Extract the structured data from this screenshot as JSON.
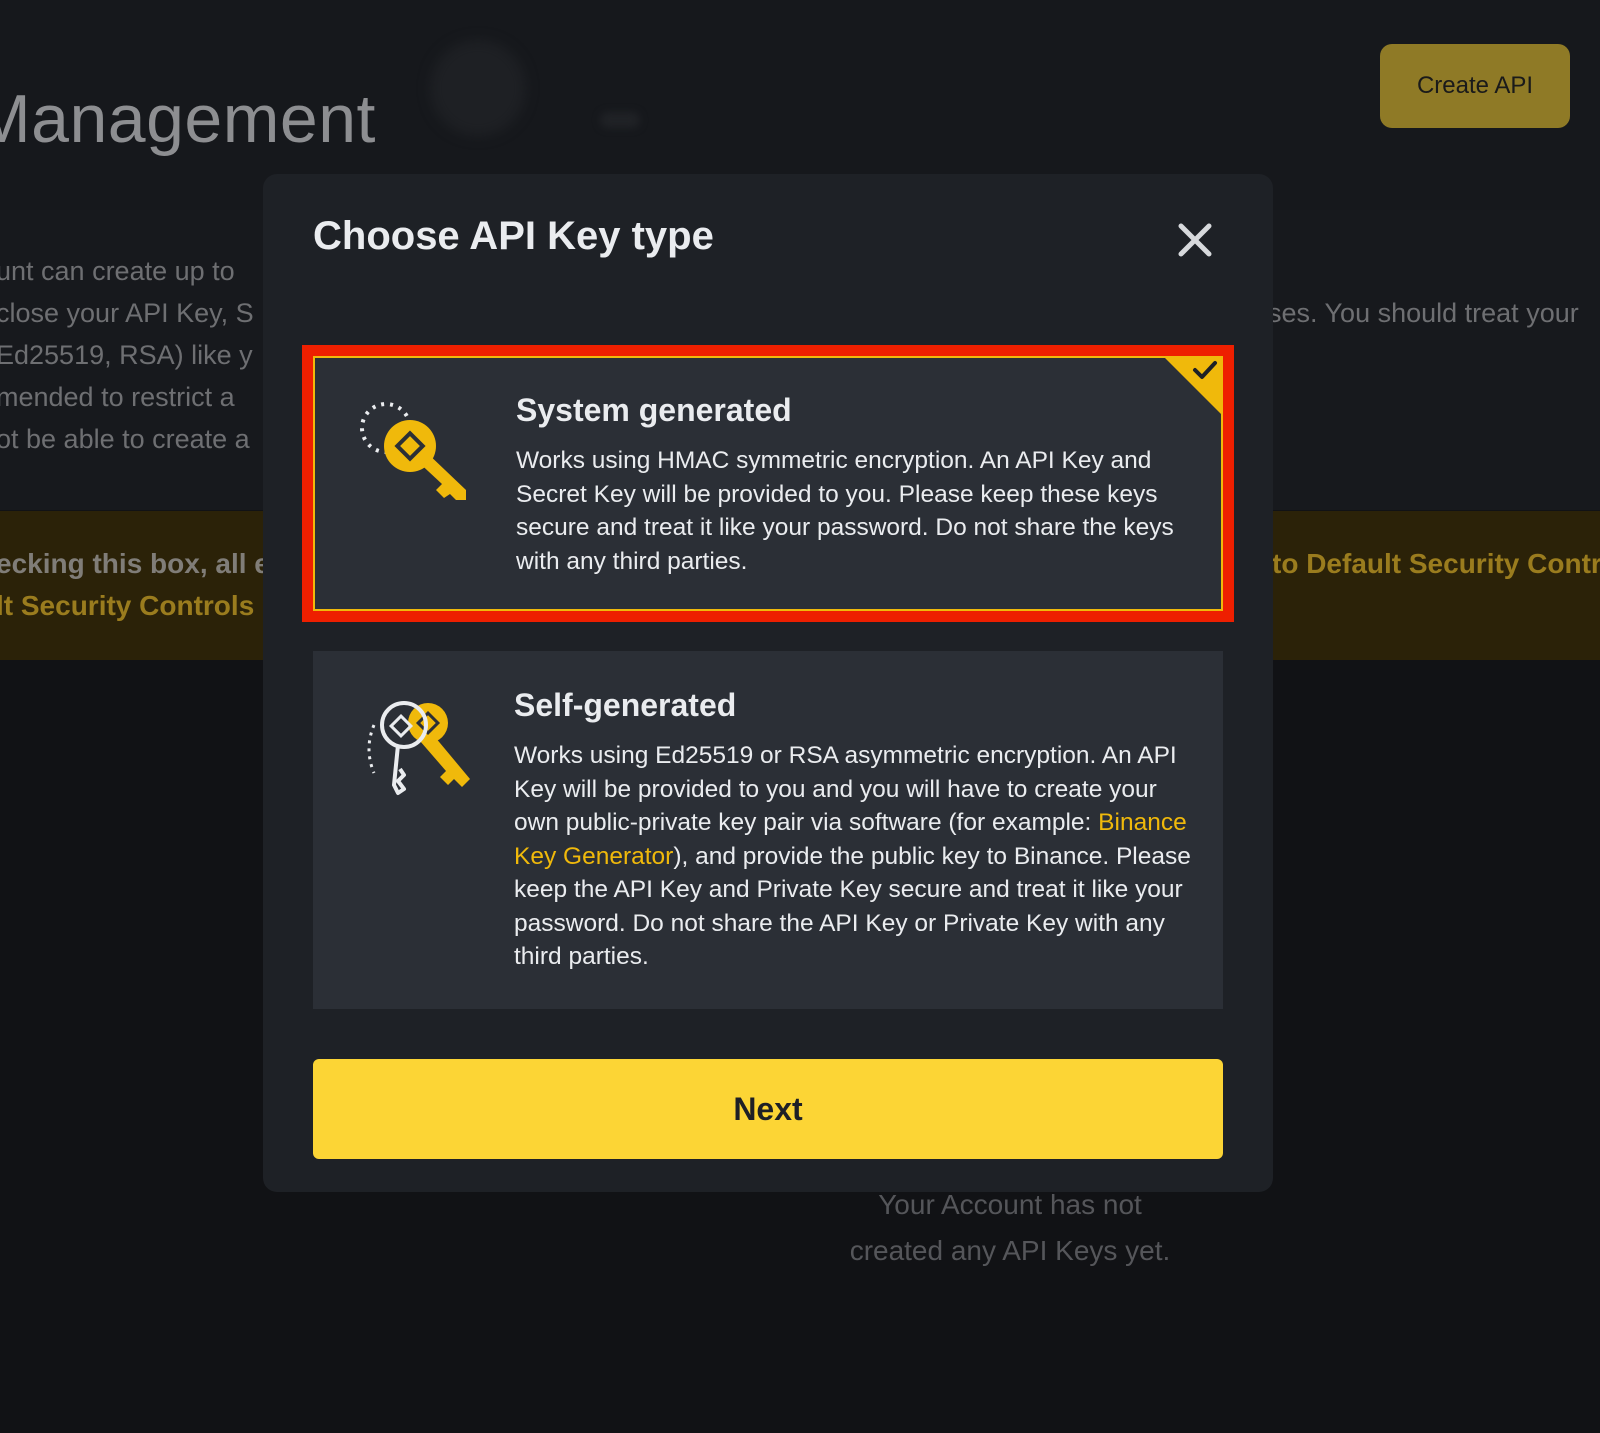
{
  "background": {
    "page_title": "Management",
    "create_api_label": "Create API",
    "info_lines": [
      "unt can create up to",
      "close your API Key, S",
      "Ed25519, RSA) like y",
      "mended to restrict a",
      "ot be able to create a"
    ],
    "info_right_line": "ses. You should treat your",
    "warning_left_lines": [
      "ecking this box, all e",
      "lt Security Controls I"
    ],
    "warning_right_line": "to Default Security Contr",
    "empty_state_lines": [
      "Your Account has not",
      "created any API Keys yet."
    ]
  },
  "modal": {
    "title": "Choose API Key type",
    "close_icon": "close-icon",
    "options": [
      {
        "title": "System generated",
        "description": "Works using HMAC symmetric encryption. An API Key and Secret Key will be provided to you. Please keep these keys secure and treat it like your password. Do not share the keys with any third parties.",
        "icon": "key-icon",
        "selected": true
      },
      {
        "title": "Self-generated",
        "description_before_link": "Works using Ed25519 or RSA asymmetric encryption. An API Key will be provided to you and you will have to create your own public-private key pair via software (for example: ",
        "link_text": "Binance Key Generator",
        "description_after_link": "), and provide the public key to Binance. Please keep the API Key and Private Key secure and treat it like your password. Do not share the API Key or Private Key with any third parties.",
        "icon": "keys-pair-icon",
        "selected": false
      }
    ],
    "next_label": "Next"
  },
  "colors": {
    "accent_yellow": "#fcd535",
    "brand_yellow": "#f0b90b",
    "modal_bg": "#1e2126",
    "card_bg": "#2b2f36",
    "highlight_red": "#ee1f00"
  }
}
